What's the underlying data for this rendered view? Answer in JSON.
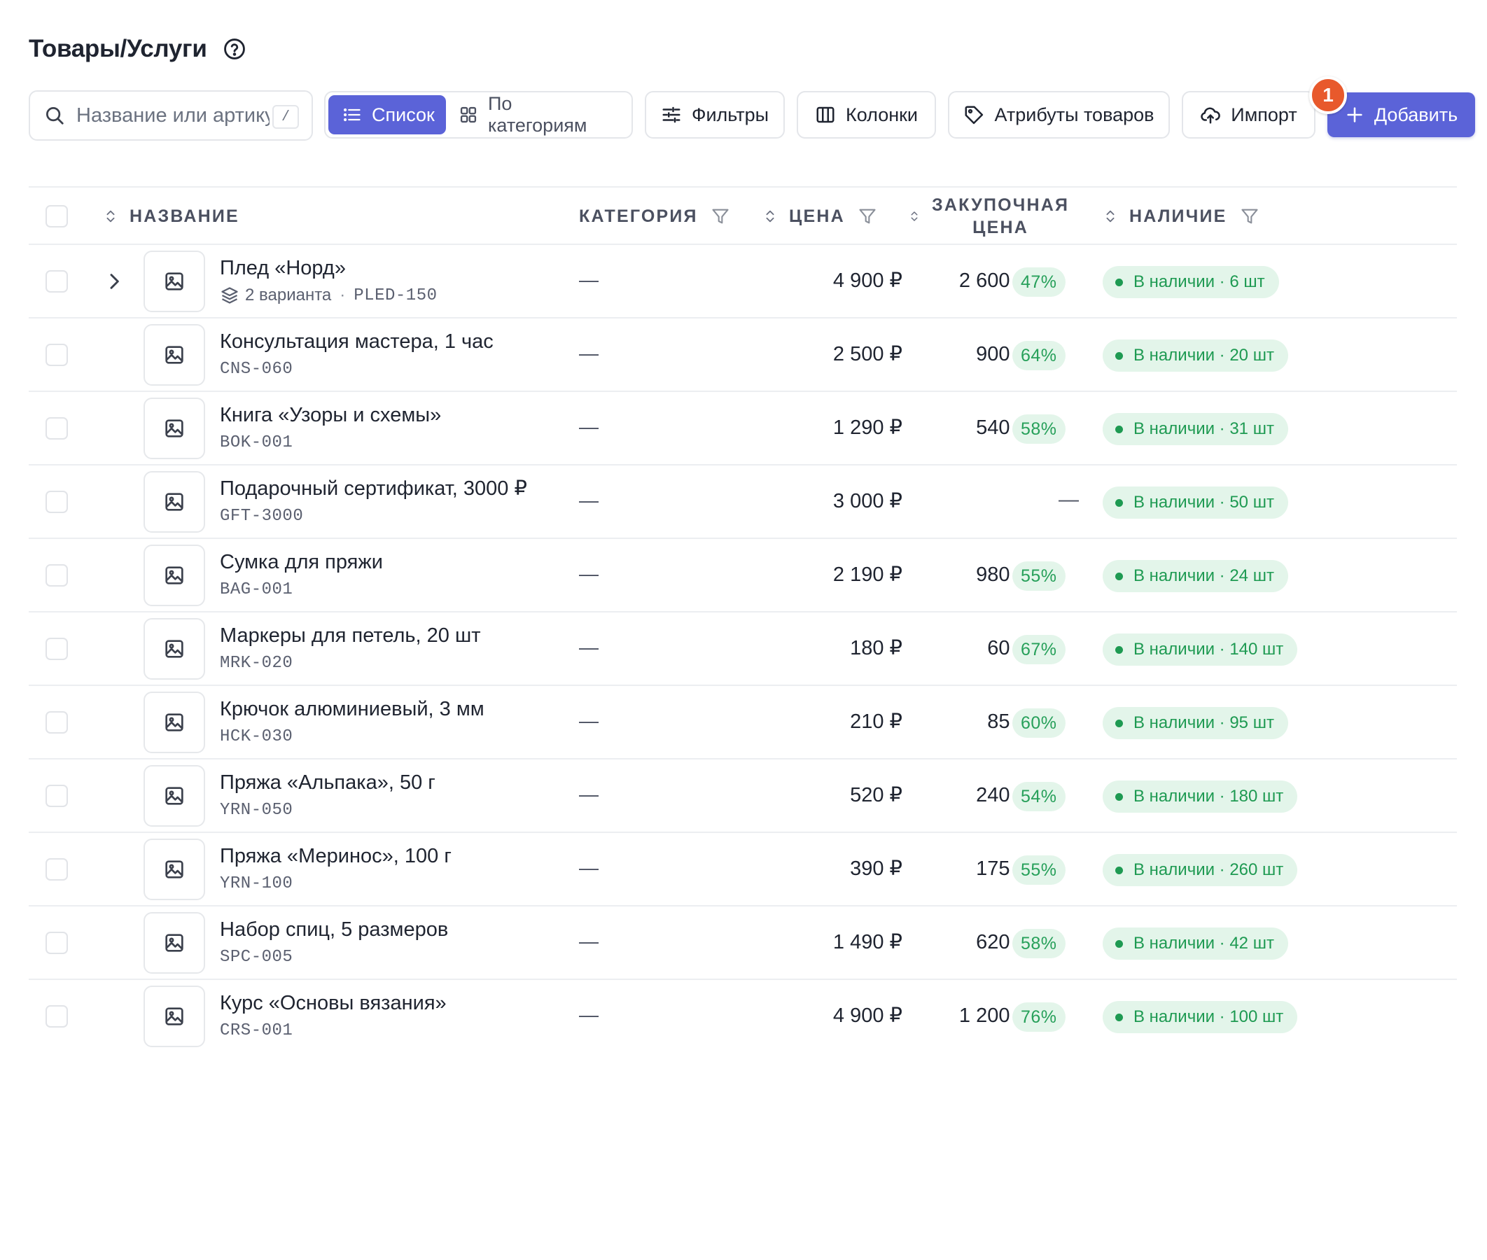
{
  "header": {
    "title": "Товары/Услуги"
  },
  "toolbar": {
    "search_placeholder": "Название или артикул",
    "search_shortcut": "/",
    "view_list": "Список",
    "view_categories": "По категориям",
    "filters": "Фильтры",
    "columns": "Колонки",
    "attributes": "Атрибуты товаров",
    "import": "Импорт",
    "add": "Добавить",
    "badge_count": "1"
  },
  "colors": {
    "accent": "#5b63d8",
    "badge": "#e8592c",
    "success": "#1e9a52",
    "success_bg": "#e3f5ea"
  },
  "icons": [
    "help-icon",
    "search-icon",
    "list-icon",
    "grid-icon",
    "sliders-icon",
    "columns-icon",
    "tag-icon",
    "cloud-upload-icon",
    "plus-icon",
    "sort-icon",
    "funnel-icon",
    "image-icon",
    "chevron-right-icon",
    "layers-icon"
  ],
  "table": {
    "columns": {
      "name": "НАЗВАНИЕ",
      "category": "КАТЕГОРИЯ",
      "price": "ЦЕНА",
      "cost_line1": "ЗАКУПОЧНАЯ",
      "cost_line2": "ЦЕНА",
      "stock": "НАЛИЧИЕ"
    },
    "rows": [
      {
        "name": "Плед «Норд»",
        "variants": "2 варианта",
        "sku": "PLED-150",
        "category": "—",
        "price": "4 900 ₽",
        "cost": "2 600 ₽",
        "margin": "47%",
        "stock": "В наличии · 6 шт"
      },
      {
        "name": "Консультация мастера, 1 час",
        "sku": "CNS-060",
        "category": "—",
        "price": "2 500 ₽",
        "cost": "900 ₽",
        "margin": "64%",
        "stock": "В наличии · 20 шт"
      },
      {
        "name": "Книга «Узоры и схемы»",
        "sku": "BOK-001",
        "category": "—",
        "price": "1 290 ₽",
        "cost": "540 ₽",
        "margin": "58%",
        "stock": "В наличии · 31 шт"
      },
      {
        "name": "Подарочный сертификат, 3000 ₽",
        "sku": "GFT-3000",
        "category": "—",
        "price": "3 000 ₽",
        "cost": "—",
        "stock": "В наличии · 50 шт"
      },
      {
        "name": "Сумка для пряжи",
        "sku": "BAG-001",
        "category": "—",
        "price": "2 190 ₽",
        "cost": "980 ₽",
        "margin": "55%",
        "stock": "В наличии · 24 шт"
      },
      {
        "name": "Маркеры для петель, 20 шт",
        "sku": "MRK-020",
        "category": "—",
        "price": "180 ₽",
        "cost": "60 ₽",
        "margin": "67%",
        "stock": "В наличии · 140 шт"
      },
      {
        "name": "Крючок алюминиевый, 3 мм",
        "sku": "HCK-030",
        "category": "—",
        "price": "210 ₽",
        "cost": "85 ₽",
        "margin": "60%",
        "stock": "В наличии · 95 шт"
      },
      {
        "name": "Пряжа «Альпака», 50 г",
        "sku": "YRN-050",
        "category": "—",
        "price": "520 ₽",
        "cost": "240 ₽",
        "margin": "54%",
        "stock": "В наличии · 180 шт"
      },
      {
        "name": "Пряжа «Меринос», 100 г",
        "sku": "YRN-100",
        "category": "—",
        "price": "390 ₽",
        "cost": "175 ₽",
        "margin": "55%",
        "stock": "В наличии · 260 шт"
      },
      {
        "name": "Набор спиц, 5 размеров",
        "sku": "SPC-005",
        "category": "—",
        "price": "1 490 ₽",
        "cost": "620 ₽",
        "margin": "58%",
        "stock": "В наличии · 42 шт"
      },
      {
        "name": "Курс «Основы вязания»",
        "sku": "CRS-001",
        "category": "—",
        "price": "4 900 ₽",
        "cost": "1 200 ₽",
        "margin": "76%",
        "stock": "В наличии · 100 шт"
      }
    ]
  }
}
